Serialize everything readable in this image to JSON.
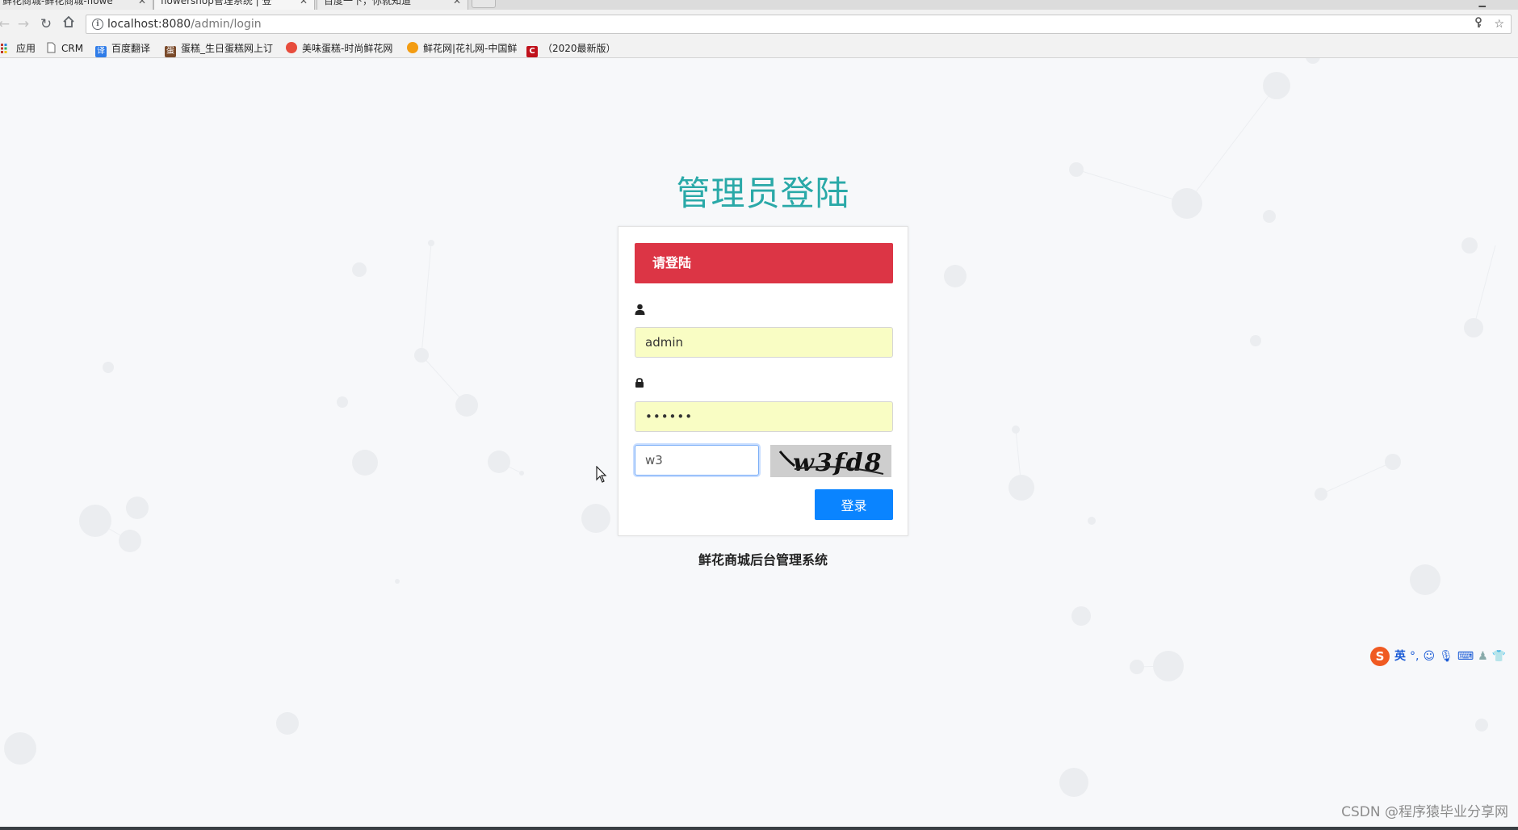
{
  "browser": {
    "tabs": [
      {
        "title": "鲜花商城-鲜花商城-flowe",
        "active": false
      },
      {
        "title": "flowershop管理系统 | 登",
        "active": true
      },
      {
        "title": "百度一下，你就知道",
        "active": false
      }
    ],
    "url": {
      "host": "localhost:8080",
      "path": "/admin/login"
    },
    "bookmarks": [
      {
        "label": "应用",
        "icon": "apps-grid-icon"
      },
      {
        "label": "CRM",
        "icon": "page-icon"
      },
      {
        "label": "百度翻译",
        "icon": "baidu-translate-icon"
      },
      {
        "label": "蛋糕_生日蛋糕网上订",
        "icon": "cake-site-icon"
      },
      {
        "label": "美味蛋糕-时尚鲜花网",
        "icon": "flower-site-icon"
      },
      {
        "label": "鲜花网|花礼网-中国鲜",
        "icon": "hualiwang-icon"
      },
      {
        "label": "（2020最新版）",
        "icon": "csdn-c-icon"
      }
    ]
  },
  "login": {
    "title": "管理员登陆",
    "card_header": "请登陆",
    "username": {
      "value": "admin",
      "icon": "user-icon"
    },
    "password": {
      "value": "••••••",
      "icon": "lock-icon"
    },
    "captcha": {
      "value": "w3",
      "image_text": "w3fd8"
    },
    "submit_label": "登录",
    "system_name": "鲜花商城后台管理系统"
  },
  "ime": {
    "logo": "S",
    "mode": "英",
    "icons": [
      "punctuation-icon",
      "emoji-icon",
      "microphone-icon",
      "keyboard-icon",
      "user-icon",
      "skin-icon"
    ]
  },
  "watermark": "CSDN @程序猿毕业分享网",
  "colors": {
    "title": "#2aa9a8",
    "header_bg": "#dc3545",
    "button_bg": "#0a84ff",
    "autofill_bg": "#f9fdc4"
  }
}
